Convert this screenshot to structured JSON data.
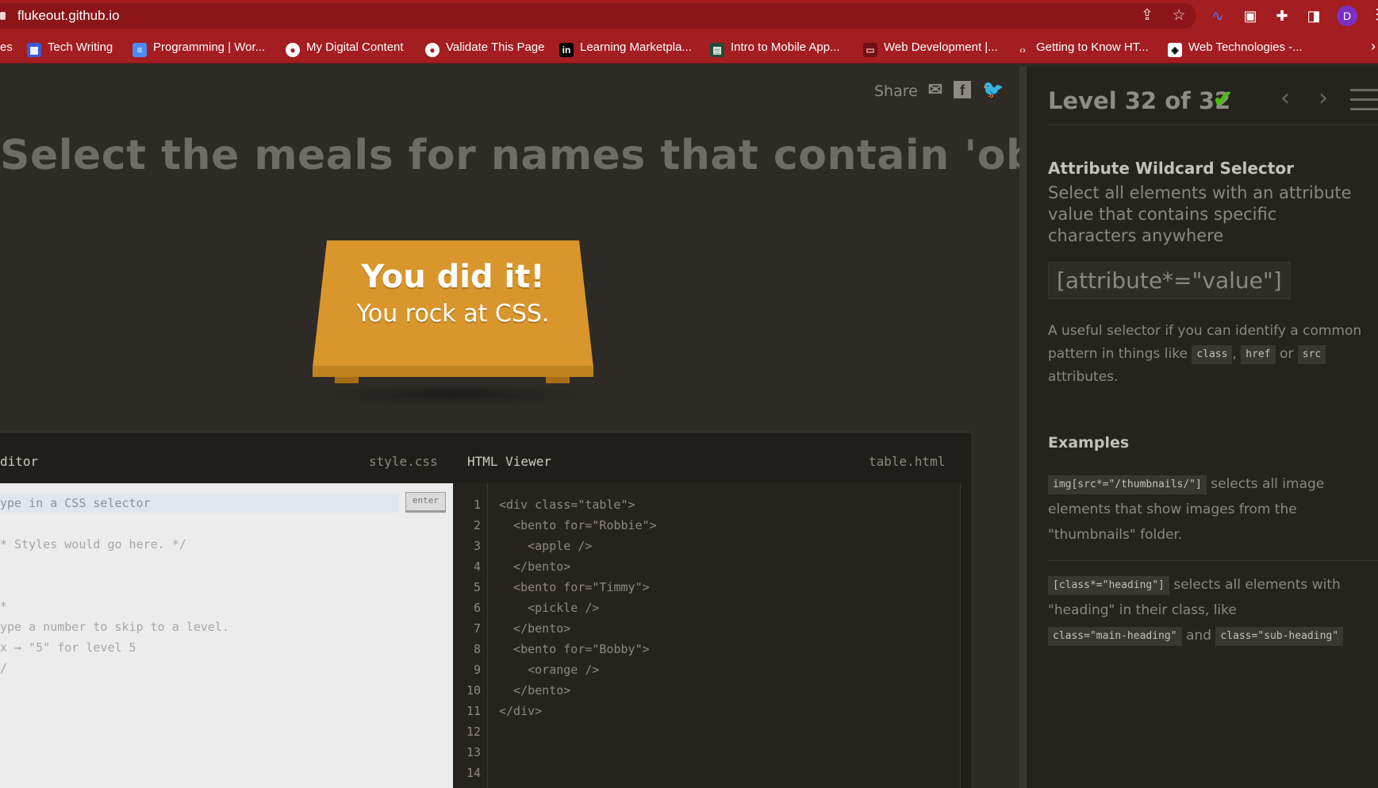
{
  "browser": {
    "url": "flukeout.github.io",
    "avatar_initial": "D",
    "bookmarks": [
      {
        "label": "es",
        "icon": "none"
      },
      {
        "label": "Tech Writing",
        "icon": "site-layout-icon"
      },
      {
        "label": "Programming | Wor...",
        "icon": "docs-icon"
      },
      {
        "label": "My Digital Content",
        "icon": "globe-icon"
      },
      {
        "label": "Validate This Page",
        "icon": "globe-icon"
      },
      {
        "label": "Learning Marketpla...",
        "icon": "linkedin-learning-icon"
      },
      {
        "label": "Intro to Mobile App...",
        "icon": "course-icon"
      },
      {
        "label": "Web Development |...",
        "icon": "page-icon"
      },
      {
        "label": "Getting to Know HT...",
        "icon": "code-icon"
      },
      {
        "label": "Web Technologies -...",
        "icon": "codepen-icon"
      }
    ]
  },
  "game": {
    "share_label": "Share",
    "order": "Select the meals for names that contain 'obb'",
    "win_title": "You did it!",
    "win_subtitle": "You rock at CSS."
  },
  "editor": {
    "css_title": "ditor",
    "css_file": "style.css",
    "html_title": "HTML Viewer",
    "html_file": "table.html",
    "input_placeholder": "ype in a CSS selector",
    "enter_label": "enter",
    "css_comments": [
      "* Styles would go here. */",
      "*",
      "ype a number to skip to a level.",
      "x → \"5\" for level 5",
      "/"
    ],
    "line_numbers": [
      "1",
      "2",
      "3",
      "4",
      "5",
      "6",
      "7",
      "8",
      "9",
      "10",
      "11",
      "12",
      "13",
      "14"
    ],
    "html_lines": [
      "<div class=\"table\">",
      "  <bento for=\"Robbie\">",
      "    <apple />",
      "  </bento>",
      "  <bento for=\"Timmy\">",
      "    <pickle />",
      "  </bento>",
      "  <bento for=\"Bobby\">",
      "    <orange />",
      "  </bento>",
      "</div>"
    ]
  },
  "sidebar": {
    "level_text": "Level 32 of 32",
    "selector_name": "Attribute Wildcard Selector",
    "title": "Select all elements with an attribute value that contains specific characters anywhere",
    "syntax": "[attribute*=\"value\"]",
    "hint_before": "A useful selector if you can identify a common pattern in things like",
    "hint_tags": [
      "class",
      "href",
      "src"
    ],
    "hint_sep1": ",",
    "hint_sep2": "or",
    "hint_after": "attributes.",
    "examples_heading": "Examples",
    "example1_code": "img[src*=\"/thumbnails/\"]",
    "example1_text": "selects all image elements that show images from the \"thumbnails\" folder.",
    "example2_code": "[class*=\"heading\"]",
    "example2_text": "selects all elements with \"heading\" in their class, like",
    "example2_code2": "class=\"main-heading\"",
    "example2_and": "and",
    "example2_code3": "class=\"sub-heading\""
  }
}
